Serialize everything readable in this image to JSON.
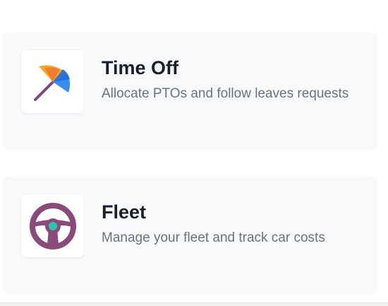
{
  "cards": [
    {
      "title": "Time Off",
      "description": "Allocate PTOs and follow leaves requests",
      "icon": "umbrella-icon",
      "colors": [
        "#f6a72a",
        "#f07d2a",
        "#3b8cf0",
        "#1f6fde",
        "#7b4a86"
      ]
    },
    {
      "title": "Fleet",
      "description": "Manage your fleet and track car costs",
      "icon": "steering-wheel-icon",
      "colors": [
        "#8a4a7a",
        "#2ec4b0"
      ]
    }
  ]
}
